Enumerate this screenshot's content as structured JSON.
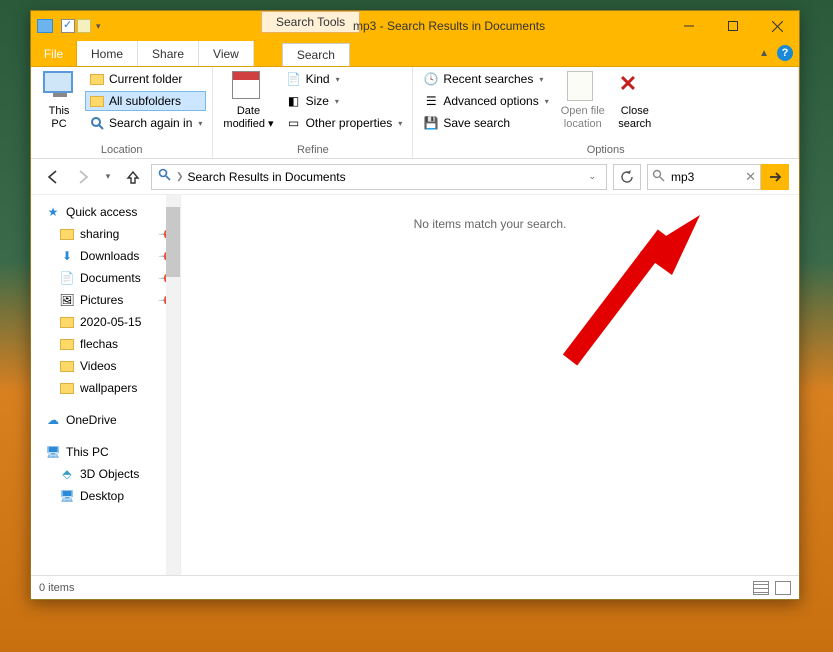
{
  "window": {
    "tool_tab": "Search Tools",
    "title": "mp3 - Search Results in Documents"
  },
  "tabs": {
    "file": "File",
    "home": "Home",
    "share": "Share",
    "view": "View",
    "search": "Search"
  },
  "ribbon": {
    "location": {
      "this_pc": "This\nPC",
      "current_folder": "Current folder",
      "all_subfolders": "All subfolders",
      "search_again": "Search again in",
      "label": "Location"
    },
    "refine": {
      "date_modified": "Date\nmodified",
      "kind": "Kind",
      "size": "Size",
      "other_props": "Other properties",
      "label": "Refine"
    },
    "options": {
      "recent": "Recent searches",
      "advanced": "Advanced options",
      "save": "Save search",
      "open_loc": "Open file\nlocation",
      "close": "Close\nsearch",
      "label": "Options"
    }
  },
  "nav": {
    "breadcrumb": "Search Results in Documents",
    "search_value": "mp3"
  },
  "tree": {
    "quick_access": "Quick access",
    "sharing": "sharing",
    "downloads": "Downloads",
    "documents": "Documents",
    "pictures": "Pictures",
    "d2020": "2020-05-15",
    "flechas": "flechas",
    "videos": "Videos",
    "wallpapers": "wallpapers",
    "onedrive": "OneDrive",
    "thispc": "This PC",
    "objects3d": "3D Objects",
    "desktop": "Desktop"
  },
  "results": {
    "empty": "No items match your search."
  },
  "status": {
    "count": "0 items"
  }
}
